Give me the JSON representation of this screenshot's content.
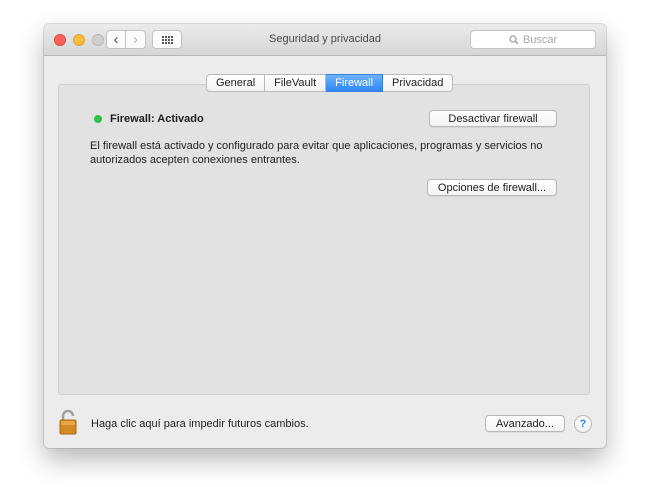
{
  "window": {
    "title": "Seguridad y privacidad",
    "search_placeholder": "Buscar"
  },
  "toolbar": {
    "back_glyph": "‹",
    "forward_glyph": "›",
    "show_all_icon": "grid-icon"
  },
  "tabs": [
    {
      "label": "General",
      "selected": false
    },
    {
      "label": "FileVault",
      "selected": false
    },
    {
      "label": "Firewall",
      "selected": true
    },
    {
      "label": "Privacidad",
      "selected": false
    }
  ],
  "firewall": {
    "status_label": "Firewall: Activado",
    "status_color": "#31c148",
    "description": "El firewall está activado y configurado para evitar que aplicaciones, programas y servicios no autorizados acepten conexiones entrantes.",
    "deactivate_button": "Desactivar firewall",
    "options_button": "Opciones de firewall..."
  },
  "footer": {
    "lock_text": "Haga clic aquí para impedir futuros cambios.",
    "lock_icon": "unlocked-padlock-icon",
    "advanced_button": "Avanzado...",
    "help_glyph": "?"
  },
  "colors": {
    "accent": "#2f86f2",
    "close": "#fc605b",
    "minimize": "#fdbc40"
  }
}
